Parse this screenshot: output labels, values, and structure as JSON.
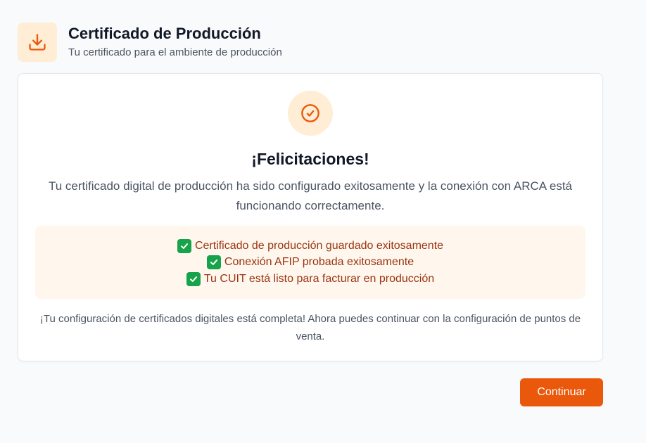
{
  "header": {
    "icon": "download-icon",
    "title": "Certificado de Producción",
    "subtitle": "Tu certificado para el ambiente de producción"
  },
  "card": {
    "status_icon": "check-circle-icon",
    "heading": "¡Felicitaciones!",
    "message": "Tu certificado digital de producción ha sido configurado exitosamente y la conexión con ARCA está funcionando correctamente.",
    "success_items": [
      {
        "icon": "check-mark-button-emoji",
        "text": "Certificado de producción guardado exitosamente"
      },
      {
        "icon": "check-mark-button-emoji",
        "text": "Conexión AFIP probada exitosamente"
      },
      {
        "icon": "check-mark-button-emoji",
        "text": "Tu CUIT está listo para facturar en producción"
      }
    ],
    "footer": "¡Tu configuración de certificados digitales está completa! Ahora puedes continuar con la configuración de puntos de venta."
  },
  "actions": {
    "continue_label": "Continuar"
  },
  "colors": {
    "accent": "#ea580c",
    "accent_light": "#ffedd5",
    "success_bg": "#fff7ed",
    "success_text": "#9a3412",
    "emoji_green": "#16a34a"
  }
}
